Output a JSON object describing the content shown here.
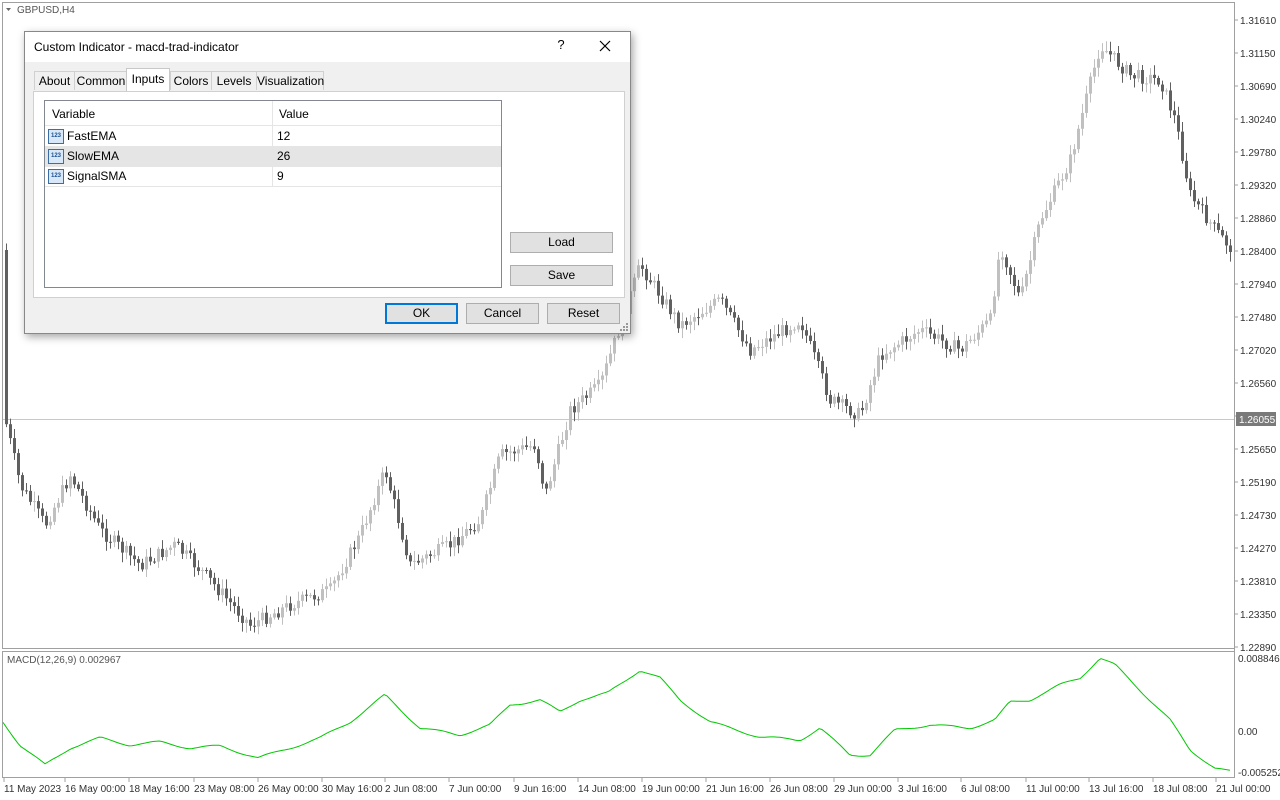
{
  "chart": {
    "symbol_label": "GBPUSD,H4",
    "price_axis": [
      "1.31610",
      "1.31150",
      "1.30690",
      "1.30240",
      "1.29780",
      "1.29320",
      "1.28860",
      "1.28400",
      "1.27940",
      "1.27480",
      "1.27020",
      "1.26560",
      "1.26100",
      "1.25650",
      "1.25190",
      "1.24730",
      "1.24270",
      "1.23810",
      "1.23350",
      "1.22890"
    ],
    "current_price": "1.26055",
    "time_axis": [
      "11 May 2023",
      "16 May 00:00",
      "18 May 16:00",
      "23 May 08:00",
      "26 May 00:00",
      "30 May 16:00",
      "2 Jun 08:00",
      "7 Jun 00:00",
      "9 Jun 16:00",
      "14 Jun 08:00",
      "19 Jun 00:00",
      "21 Jun 16:00",
      "26 Jun 08:00",
      "29 Jun 00:00",
      "3 Jul 16:00",
      "6 Jul 08:00",
      "11 Jul 00:00",
      "13 Jul 16:00",
      "18 Jul 08:00",
      "21 Jul 00:00"
    ],
    "macd_label": "MACD(12,26,9) 0.002967",
    "macd_axis": [
      "0.008846",
      "0.00",
      "-0.005252"
    ],
    "colors": {
      "bull": "#c0c0c0",
      "bear": "#606060",
      "macd_line": "#00c800",
      "bid_line": "#c8c8c8",
      "price_label_bg": "#7a7a7a"
    }
  },
  "dialog": {
    "title": "Custom Indicator - macd-trad-indicator",
    "help_label": "?",
    "tabs": [
      "About",
      "Common",
      "Inputs",
      "Colors",
      "Levels",
      "Visualization"
    ],
    "active_tab": "Inputs",
    "grid": {
      "headers": [
        "Variable",
        "Value"
      ],
      "icon_text": "123",
      "rows": [
        {
          "name": "FastEMA",
          "value": "12"
        },
        {
          "name": "SlowEMA",
          "value": "26"
        },
        {
          "name": "SignalSMA",
          "value": "9"
        }
      ]
    },
    "load_label": "Load",
    "save_label": "Save",
    "ok_label": "OK",
    "cancel_label": "Cancel",
    "reset_label": "Reset"
  }
}
